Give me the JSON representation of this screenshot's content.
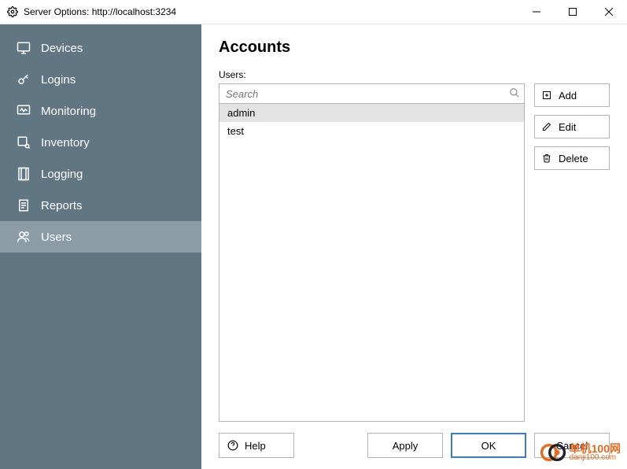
{
  "window": {
    "title": "Server Options: http://localhost:3234"
  },
  "sidebar": {
    "items": [
      {
        "label": "Devices"
      },
      {
        "label": "Logins"
      },
      {
        "label": "Monitoring"
      },
      {
        "label": "Inventory"
      },
      {
        "label": "Logging"
      },
      {
        "label": "Reports"
      },
      {
        "label": "Users"
      }
    ]
  },
  "page": {
    "title": "Accounts",
    "section_label": "Users:",
    "search_placeholder": "Search"
  },
  "users": [
    {
      "name": "admin",
      "selected": true
    },
    {
      "name": "test",
      "selected": false
    }
  ],
  "actions": {
    "add": "Add",
    "edit": "Edit",
    "delete": "Delete"
  },
  "footer": {
    "help": "Help",
    "apply": "Apply",
    "ok": "OK",
    "cancel": "Cancel"
  },
  "watermark": {
    "main": "单机100网",
    "sub": "danji100.com"
  }
}
